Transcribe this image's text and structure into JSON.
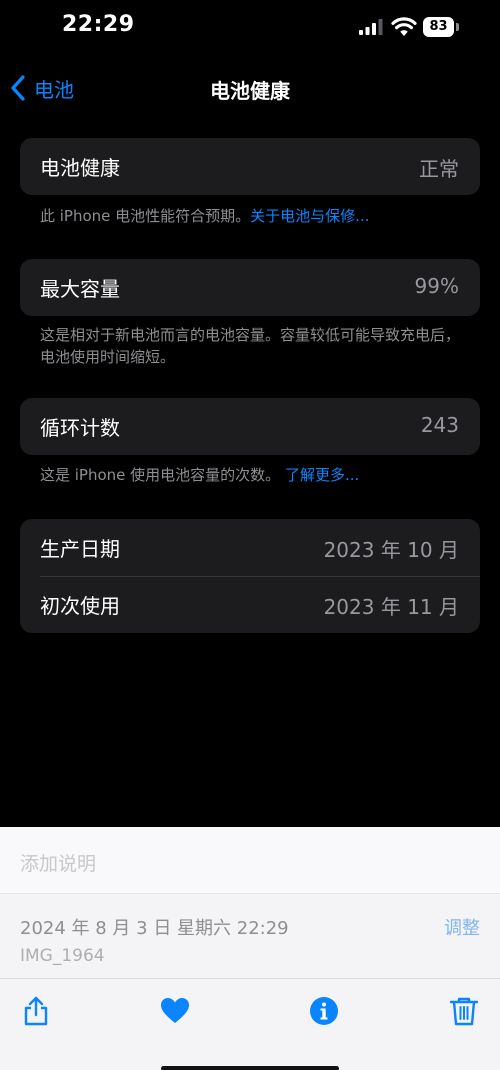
{
  "status_bar": {
    "time": "22:29",
    "battery_percent": "83"
  },
  "nav": {
    "back_label": "电池",
    "title": "电池健康"
  },
  "sections": {
    "health": {
      "label": "电池健康",
      "value": "正常",
      "footnote": "此 iPhone 电池性能符合预期。",
      "link": "关于电池与保修..."
    },
    "capacity": {
      "label": "最大容量",
      "value": "99%",
      "footnote": "这是相对于新电池而言的电池容量。容量较低可能导致充电后，电池使用时间缩短。"
    },
    "cycles": {
      "label": "循环计数",
      "value": "243",
      "footnote": "这是 iPhone 使用电池容量的次数。",
      "link": "了解更多..."
    },
    "dates": {
      "manufacture_label": "生产日期",
      "manufacture_value": "2023 年 10 月",
      "first_use_label": "初次使用",
      "first_use_value": "2023 年 11 月"
    }
  },
  "photo_sheet": {
    "caption_placeholder": "添加说明",
    "date": "2024 年 8 月 3 日 星期六 22:29",
    "filename": "IMG_1964",
    "adjust_label": "调整"
  },
  "toolbar": {
    "icons": [
      "share-icon",
      "heart-icon",
      "info-icon",
      "trash-icon"
    ]
  },
  "colors": {
    "accent": "#0a84ff",
    "card": "#1c1c1e",
    "secondary_text": "#98989e",
    "footnote": "#8e8e93"
  }
}
